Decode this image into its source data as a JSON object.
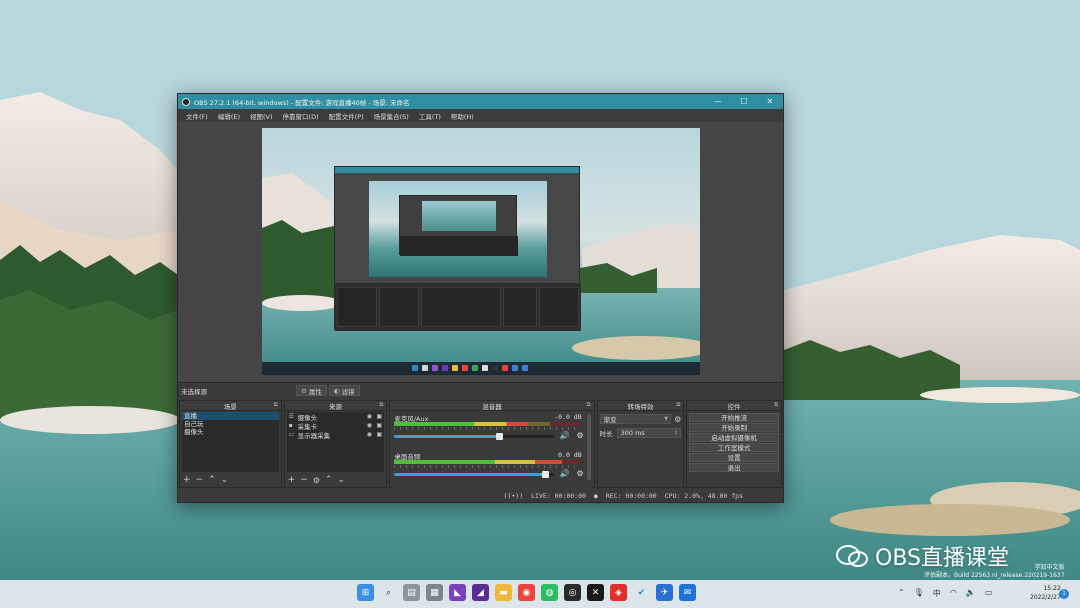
{
  "window": {
    "title": "OBS 27.2.1 (64-bit, windows) - 配置文件: 游戏直播40帧 - 场景: 未命名",
    "minimize": "—",
    "maximize": "☐",
    "close": "✕"
  },
  "menu": [
    "文件(F)",
    "编辑(E)",
    "视图(V)",
    "停靠窗口(D)",
    "配置文件(P)",
    "场景集合(S)",
    "工具(T)",
    "帮助(H)"
  ],
  "scene_bar": {
    "no_source": "未选择源",
    "properties": "属性",
    "filters": "滤镜"
  },
  "scenes": {
    "title": "场景",
    "items": [
      "直播",
      "自己玩",
      "摄像头"
    ],
    "selected": 0
  },
  "sources": {
    "title": "来源",
    "items": [
      {
        "name": "摄像头",
        "icon": "list-icon"
      },
      {
        "name": "采集卡",
        "icon": "camera-icon"
      },
      {
        "name": "显示器采集",
        "icon": "monitor-icon"
      }
    ]
  },
  "mixer": {
    "title": "混音器",
    "channels": [
      {
        "name": "麦克风/Aux",
        "db": "-0.0 dB",
        "meter": 0.72,
        "volume": 0.66
      },
      {
        "name": "桌面音频",
        "db": "0.0 dB",
        "meter": 0.9,
        "volume": 0.95
      }
    ]
  },
  "transitions": {
    "title": "转场特效",
    "type": "渐变",
    "duration_label": "时长",
    "duration": "300 ms"
  },
  "controls": {
    "title": "控件",
    "buttons": [
      "开始推流",
      "开始录制",
      "启动虚拟摄像机",
      "工作室模式",
      "设置",
      "退出"
    ]
  },
  "status": {
    "live": "LIVE: 00:00:00",
    "rec": "REC: 00:00:00",
    "cpu": "CPU: 2.0%, 48.00 fps"
  },
  "taskbar": {
    "time": "15:22",
    "date": "2022/2/27",
    "ime": "中",
    "notifications": "1"
  },
  "watermark": {
    "line1": "评估副本。Build 22563.ni_release.220219-1637",
    "mini": "学知中文版"
  },
  "brand": "OBS直播课堂",
  "colors": {
    "titlebar": "#2f8fa2",
    "selection": "#1d4f6e",
    "volume": "#3aa0e0"
  }
}
